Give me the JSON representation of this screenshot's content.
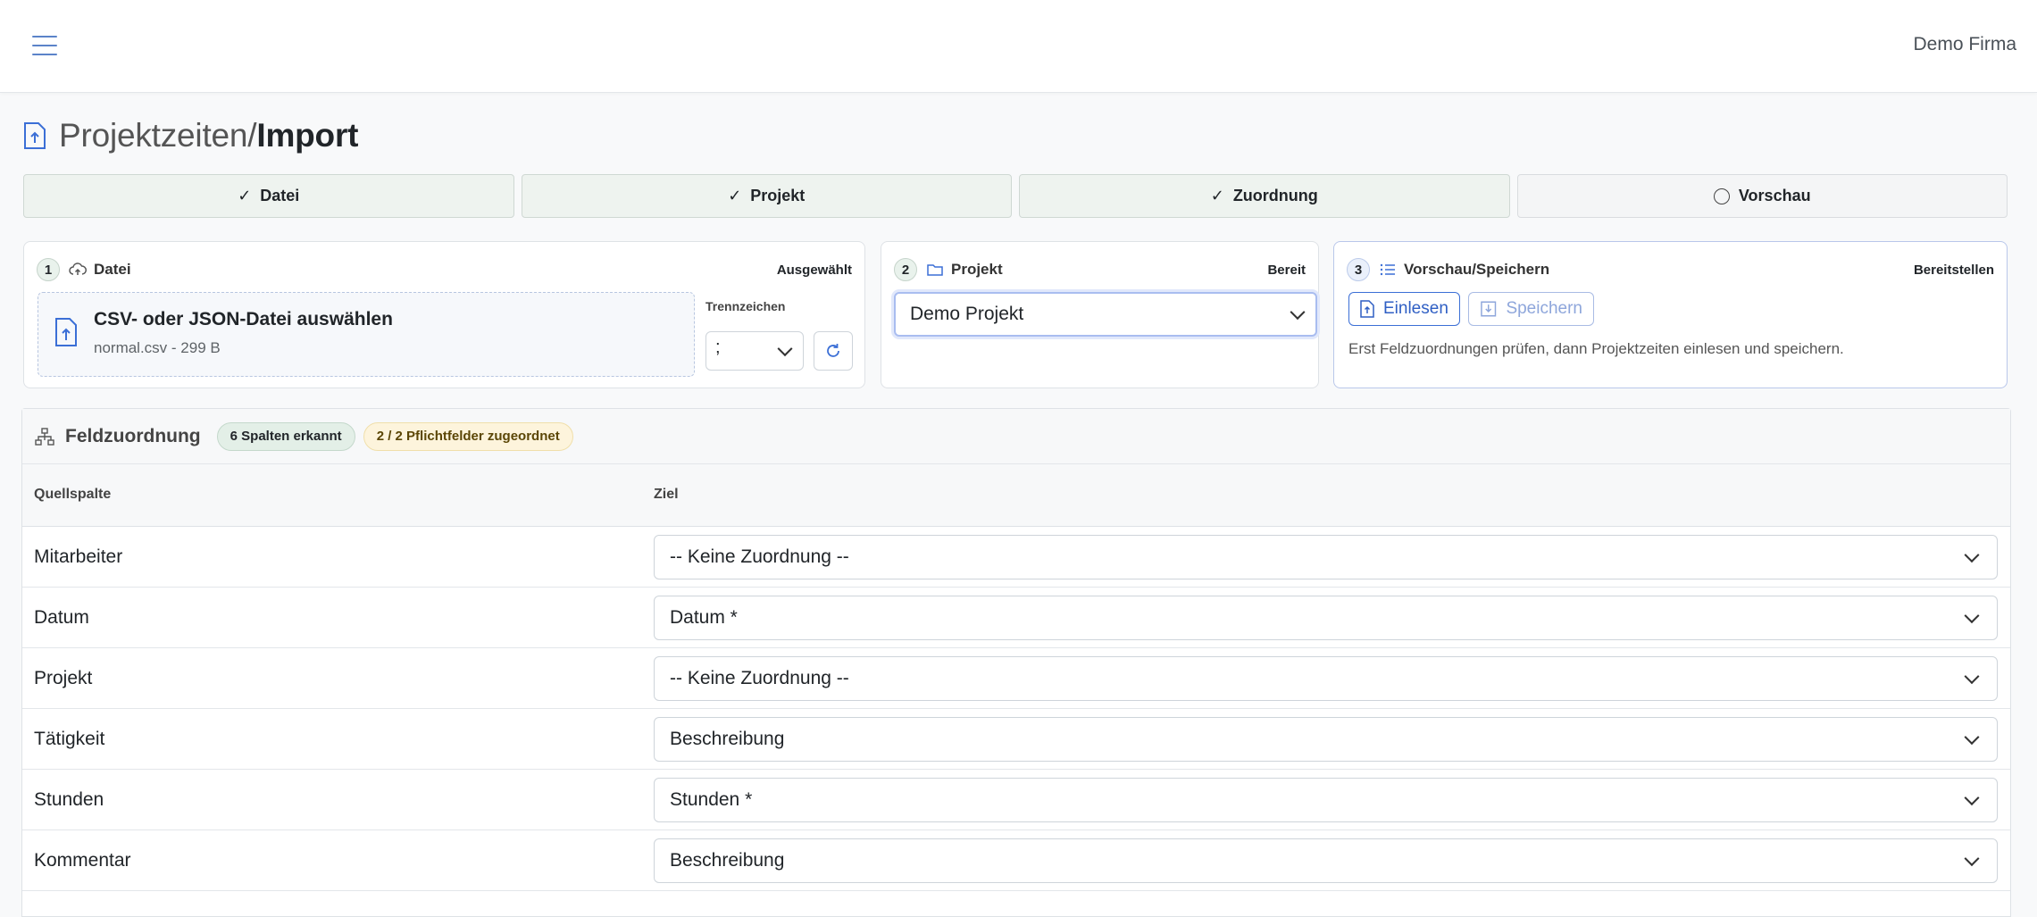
{
  "topbar": {
    "company": "Demo Firma"
  },
  "page": {
    "title_prefix": "Projektzeiten/",
    "title_main": "Import"
  },
  "stepper": [
    {
      "label": "Datei",
      "state": "done"
    },
    {
      "label": "Projekt",
      "state": "done"
    },
    {
      "label": "Zuordnung",
      "state": "done"
    },
    {
      "label": "Vorschau",
      "state": "pending"
    }
  ],
  "card_file": {
    "number": "1",
    "label": "Datei",
    "status": "Ausgewählt",
    "drop_title": "CSV- oder JSON-Datei auswählen",
    "drop_file": "normal.csv - 299 B",
    "separator_label": "Trennzeichen",
    "separator_value": ";"
  },
  "card_project": {
    "number": "2",
    "label": "Projekt",
    "status": "Bereit",
    "selected": "Demo Projekt"
  },
  "card_preview": {
    "number": "3",
    "label": "Vorschau/Speichern",
    "status": "Bereitstellen",
    "load_button": "Einlesen",
    "save_button": "Speichern",
    "hint": "Erst Feldzuordnungen prüfen, dann Projektzeiten einlesen und speichern."
  },
  "mapping": {
    "title": "Feldzuordnung",
    "badge_columns": "6 Spalten erkannt",
    "badge_required": "2 / 2 Pflichtfelder zugeordnet",
    "col_source": "Quellspalte",
    "col_target": "Ziel",
    "rows": [
      {
        "source": "Mitarbeiter",
        "target": "-- Keine Zuordnung --"
      },
      {
        "source": "Datum",
        "target": "Datum *"
      },
      {
        "source": "Projekt",
        "target": "-- Keine Zuordnung --"
      },
      {
        "source": "Tätigkeit",
        "target": "Beschreibung"
      },
      {
        "source": "Stunden",
        "target": "Stunden *"
      },
      {
        "source": "Kommentar",
        "target": "Beschreibung"
      }
    ]
  }
}
